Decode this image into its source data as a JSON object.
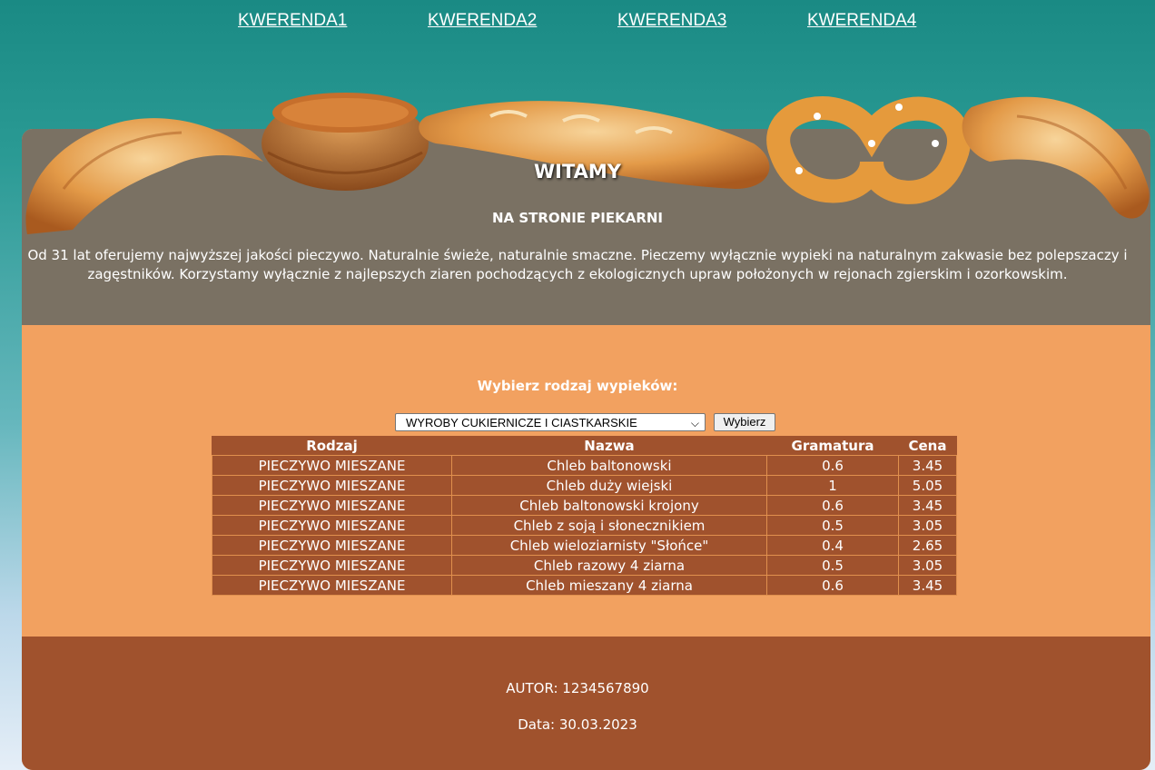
{
  "nav": [
    {
      "label": "KWERENDA1"
    },
    {
      "label": "KWERENDA2"
    },
    {
      "label": "KWERENDA3"
    },
    {
      "label": "KWERENDA4"
    }
  ],
  "header": {
    "title": "WITAMY",
    "subtitle": "NA STRONIE PIEKARNI",
    "intro": "Od 31 lat oferujemy najwyższej jakości pieczywo. Naturalnie świeże, naturalnie smaczne. Pieczemy wyłącznie wypieki na naturalnym zakwasie bez polepszaczy i zagęstników. Korzystamy wyłącznie z najlepszych ziaren pochodzących z ekologicznych upraw położonych w rejonach zgierskim i ozorkowskim."
  },
  "form": {
    "prompt": "Wybierz rodzaj wypieków:",
    "selected": "WYROBY CUKIERNICZE I CIASTKARSKIE",
    "button": "Wybierz"
  },
  "table": {
    "headers": [
      "Rodzaj",
      "Nazwa",
      "Gramatura",
      "Cena"
    ],
    "rows": [
      [
        "PIECZYWO MIESZANE",
        "Chleb baltonowski",
        "0.6",
        "3.45"
      ],
      [
        "PIECZYWO MIESZANE",
        "Chleb duży wiejski",
        "1",
        "5.05"
      ],
      [
        "PIECZYWO MIESZANE",
        "Chleb baltonowski krojony",
        "0.6",
        "3.45"
      ],
      [
        "PIECZYWO MIESZANE",
        "Chleb z soją i słonecznikiem",
        "0.5",
        "3.05"
      ],
      [
        "PIECZYWO MIESZANE",
        "Chleb wieloziarnisty \"Słońce\"",
        "0.4",
        "2.65"
      ],
      [
        "PIECZYWO MIESZANE",
        "Chleb razowy 4 ziarna",
        "0.5",
        "3.05"
      ],
      [
        "PIECZYWO MIESZANE",
        "Chleb mieszany 4 ziarna",
        "0.6",
        "3.45"
      ]
    ]
  },
  "footer": {
    "author": "AUTOR: 1234567890",
    "date": "Data: 30.03.2023"
  },
  "colors": {
    "header_bg": "#7a7163",
    "content_bg": "#f2a160",
    "table_bg": "#a0522d",
    "footer_bg": "#a0522d"
  }
}
